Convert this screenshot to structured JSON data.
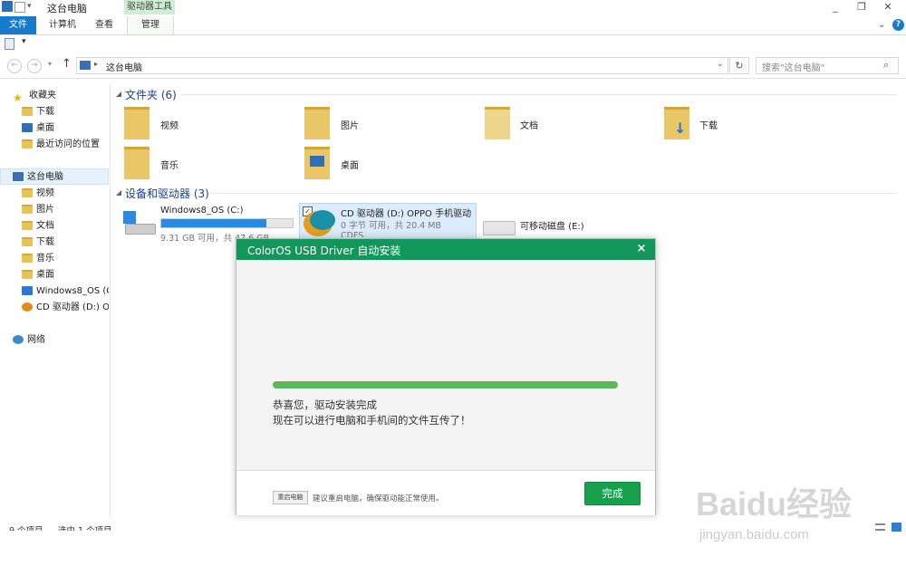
{
  "window": {
    "title": "这台电脑",
    "context_tab": "驱动器工具",
    "controls": [
      "_",
      "❐",
      "✕"
    ]
  },
  "ribbon": {
    "tabs": [
      "文件",
      "计算机",
      "查看",
      "管理"
    ],
    "help": "?"
  },
  "address": {
    "location": "这台电脑",
    "search_placeholder": "搜索\"这台电脑\""
  },
  "nav": {
    "favorites_header": "收藏夹",
    "favorites": [
      "下载",
      "桌面",
      "最近访问的位置"
    ],
    "this_pc_header": "这台电脑",
    "this_pc_items": [
      "视频",
      "图片",
      "文档",
      "下载",
      "音乐",
      "桌面",
      "Windows8_OS (C:",
      "CD 驱动器 (D:) OP"
    ],
    "network": "网络"
  },
  "content": {
    "folders_header": "文件夹 (6)",
    "folders": [
      "视频",
      "图片",
      "文档",
      "下载",
      "音乐",
      "桌面"
    ],
    "devices_header": "设备和驱动器 (3)",
    "drives": [
      {
        "name": "Windows8_OS (C:)",
        "sub": "9.31 GB 可用，共 47.6 GB",
        "used_fraction": 0.8
      },
      {
        "name": "CD 驱动器 (D:) OPPO 手机驱动",
        "sub": "0 字节 可用，共 20.4 MB",
        "fs": "CDFS"
      },
      {
        "name": "可移动磁盘 (E:)",
        "sub": ""
      }
    ]
  },
  "status": {
    "items_count": "9 个项目",
    "selected": "选中 1 个项目"
  },
  "dialog": {
    "title": "ColorOS USB Driver 自动安装",
    "close": "×",
    "progress": 1.0,
    "message_line1": "恭喜您，驱动安装完成",
    "message_line2": "现在可以进行电脑和手机间的文件互传了！",
    "restart_button": "重启电脑",
    "restart_note": "建议重启电脑，确保驱动能正常使用。",
    "finish_button": "完成"
  },
  "watermark": {
    "brand": "Baidu经验",
    "url": "jingyan.baidu.com"
  },
  "colors": {
    "accent_blue": "#1979ca",
    "dialog_green": "#11975a",
    "progress_green": "#5cb75c",
    "drive_bar": "#2e8ad8"
  }
}
